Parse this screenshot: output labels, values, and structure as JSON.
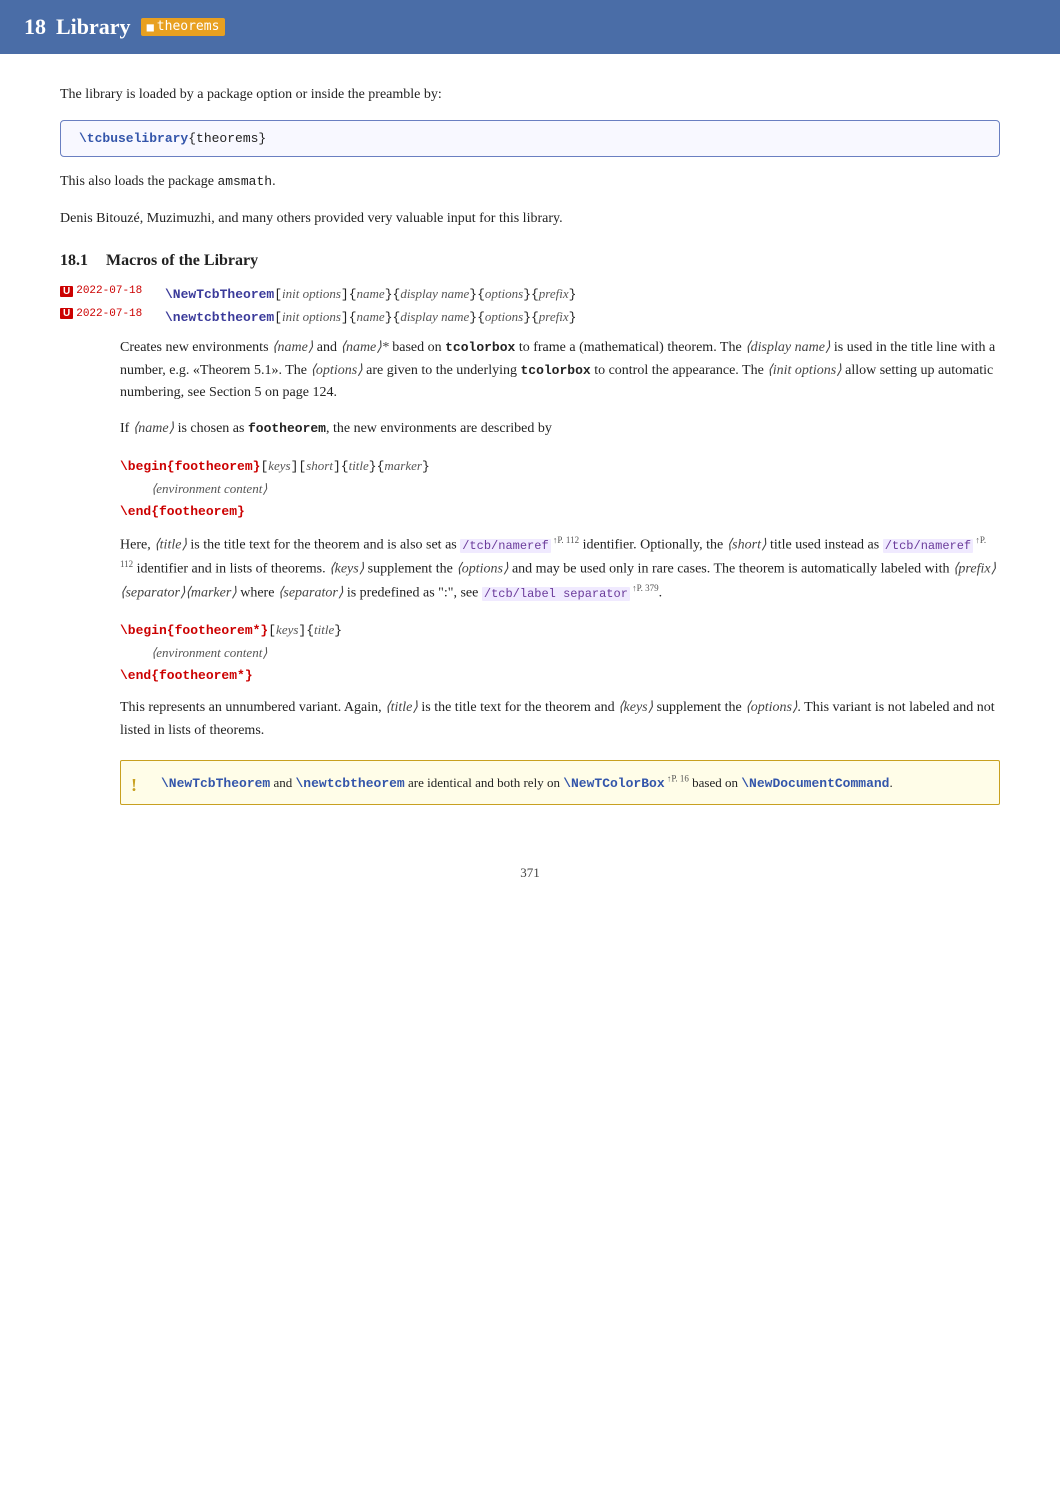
{
  "header": {
    "chapter_number": "18",
    "title_prefix": "Library",
    "library_name": "theorems"
  },
  "intro": {
    "line1": "The library is loaded by a package option or inside the preamble by:",
    "code_block": "\\tcbuselibrary{theorems}",
    "line2": "This also loads the package ",
    "amsmath": "amsmath",
    "line2_end": ".",
    "line3": "Denis Bitouzé, Muzimuzhi, and many others provided very valuable input for this library."
  },
  "section_18_1": {
    "number": "18.1",
    "title": "Macros of the Library"
  },
  "macro1": {
    "badge": "U",
    "date": "2022-07-18",
    "signature": "\\NewTcbTheorem[⟨init options⟩]{⟨name⟩}{⟨display name⟩}{⟨options⟩}{⟨prefix⟩}"
  },
  "macro2": {
    "badge": "U",
    "date": "2022-07-18",
    "signature": "\\newtcbtheorem[⟨init options⟩]{⟨name⟩}{⟨display name⟩}{⟨options⟩}{⟨prefix⟩}"
  },
  "description": {
    "p1_start": "Creates new environments ⟨name⟩ and ⟨name⟩* based on ",
    "tcolorbox": "tcolorbox",
    "p1_mid": " to frame a (mathematical) theorem.  The ⟨display name⟩ is used in the title line with a number, e.g. «Theorem 5.1».  The ⟨options⟩ are given to the underlying ",
    "tcolorbox2": "tcolorbox",
    "p1_end": " to control the appearance.  The ⟨init options⟩ allow setting up automatic numbering, see Section 5 on page 124.",
    "p2": "If ⟨name⟩ is chosen as ",
    "footheorem": "footheorem",
    "p2_end": ", the new environments are described by"
  },
  "env_begin": "\\begin{footheorem}[⟨keys⟩][⟨short⟩]{⟨title⟩}{⟨marker⟩}",
  "env_content": "    ⟨environment content⟩",
  "env_end": "\\end{footheorem}",
  "env_desc": {
    "text": "Here, ⟨title⟩ is the title text for the theorem and is also set as /tcb/nameref"
  },
  "env_star_begin": "\\begin{footheorem*}[⟨keys⟩]{⟨title⟩}",
  "env_star_content": "    ⟨environment content⟩",
  "env_star_end": "\\end{footheorem*}",
  "env_star_desc": "This represents an unnumbered variant.  Again, ⟨title⟩ is the title text for the theorem and ⟨keys⟩ supplement the ⟨options⟩.  This variant is not labeled and not listed in lists of theorems.",
  "info_box": {
    "cmd1": "\\NewTcbTheorem",
    "and": " and ",
    "cmd2": "\\newtcbtheorem",
    "mid": " are identical and both rely on ",
    "cmd3": "\\NewTColorBox",
    "ref1": "P. 16",
    "based": " based on ",
    "cmd4": "\\NewDocumentCommand",
    "end": "."
  },
  "page_number": "371"
}
